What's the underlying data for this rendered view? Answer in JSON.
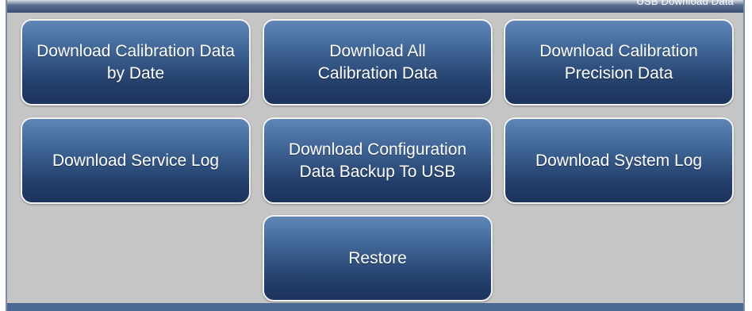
{
  "header": {
    "title": "USB Download Data"
  },
  "buttons": {
    "calibration_by_date": "Download Calibration Data\nby Date",
    "all_calibration": "Download All\nCalibration Data",
    "calibration_precision": "Download Calibration\nPrecision Data",
    "service_log": "Download Service Log",
    "config_backup": "Download Configuration\nData Backup To USB",
    "system_log": "Download System Log",
    "restore": "Restore"
  },
  "colors": {
    "button_top": "#5f86b6",
    "button_bottom": "#1c335c",
    "background": "#c5c5c5",
    "footer": "#4a6a95"
  }
}
